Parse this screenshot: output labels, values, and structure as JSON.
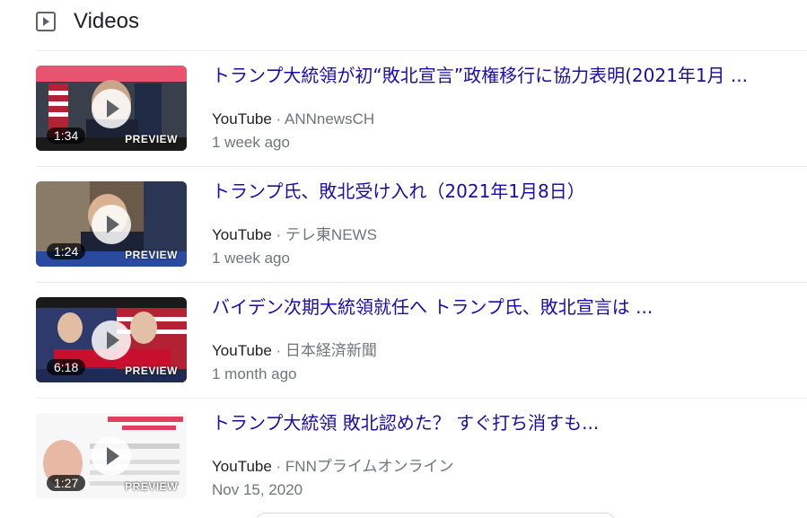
{
  "header": {
    "title": "Videos",
    "icon": "play-square-icon"
  },
  "colors": {
    "link": "#1a0dab",
    "meta": "#70757a",
    "divider": "#ebebeb"
  },
  "videos": [
    {
      "title": "トランプ大統領が初“敗北宣言”政権移行に協力表明(2021年1月 ...",
      "source": "YouTube",
      "channel": "ANNnewsCH",
      "date": "1 week ago",
      "duration": "1:34",
      "preview": "PREVIEW"
    },
    {
      "title": "トランプ氏、敗北受け入れ（2021年1月8日）",
      "source": "YouTube",
      "channel": "テレ東NEWS",
      "date": "1 week ago",
      "duration": "1:24",
      "preview": "PREVIEW"
    },
    {
      "title": "バイデン次期大統領就任へ トランプ氏、敗北宣言は ...",
      "source": "YouTube",
      "channel": "日本経済新聞",
      "date": "1 month ago",
      "duration": "6:18",
      "preview": "PREVIEW"
    },
    {
      "title": "トランプ大統領 敗北認めた？ すぐ打ち消すも...",
      "source": "YouTube",
      "channel": "FNNプライムオンライン",
      "date": "Nov 15, 2020",
      "duration": "1:27",
      "preview": "PREVIEW"
    }
  ],
  "meta_separator": " · "
}
